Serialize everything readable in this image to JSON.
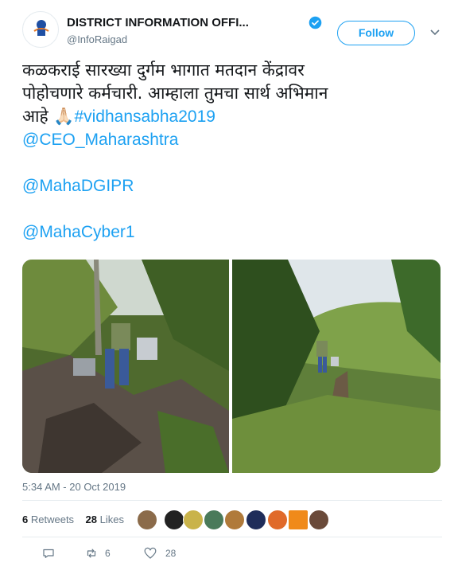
{
  "tweet": {
    "author_name": "DISTRICT INFORMATION OFFI...",
    "author_handle": "@InfoRaigad",
    "follow_label": "Follow",
    "avatar_caption": "माहिती",
    "text_line1": "कळकराई सारख्या दुर्गम भागात मतदान केंद्रावर",
    "text_line2": "पोहोचणारे कर्मचारी. आम्हाला तुमचा सार्थ अभिमान",
    "text_line3": "आहे 🙏🏻",
    "hashtag": "#vidhansabha2019",
    "mention1": "@CEO_Maharashtra",
    "mention2": "@MahaDGIPR",
    "mention3": "@MahaCyber1",
    "timestamp": "5:34 AM - 20 Oct 2019",
    "retweets_count": "6",
    "retweets_label": "Retweets",
    "likes_count": "28",
    "likes_label": "Likes",
    "retweet_action_count": "6",
    "like_action_count": "28"
  },
  "colors": {
    "link": "#1da1f2",
    "muted": "#657786",
    "text": "#14171a"
  }
}
